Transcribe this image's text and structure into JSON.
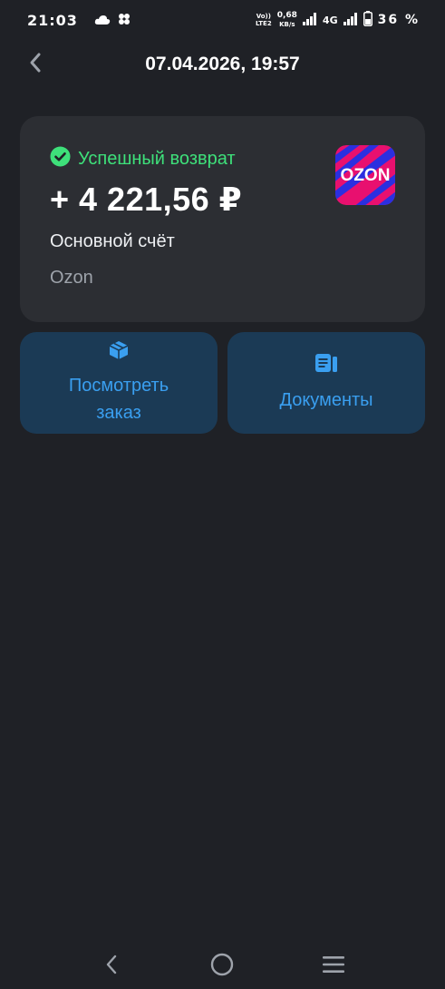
{
  "status_bar": {
    "time": "21:03",
    "volte_top": "Vo))",
    "volte_bottom": "LTE2",
    "speed_value": "0,68",
    "speed_unit": "KB/s",
    "network": "4G",
    "battery": "36 %",
    "icons": [
      "cloud-icon",
      "pinwheel-icon",
      "signal-icon",
      "signal-icon",
      "battery-icon"
    ]
  },
  "header": {
    "back_icon": "chevron-left-icon",
    "title": "07.04.2026, 19:57"
  },
  "transaction": {
    "status_icon": "check-circle-icon",
    "status": "Успешный возврат",
    "amount": "+ 4 221,56 ₽",
    "account": "Основной счёт",
    "merchant": "Ozon",
    "logo_text": "OZON",
    "status_color": "#3ee07a"
  },
  "actions": [
    {
      "icon": "box-icon",
      "label": "Посмотреть заказ"
    },
    {
      "icon": "document-icon",
      "label": "Документы"
    }
  ],
  "accent_color": "#3a9ff0",
  "nav": {
    "icons": [
      "nav-back-icon",
      "nav-home-icon",
      "nav-menu-icon"
    ]
  }
}
